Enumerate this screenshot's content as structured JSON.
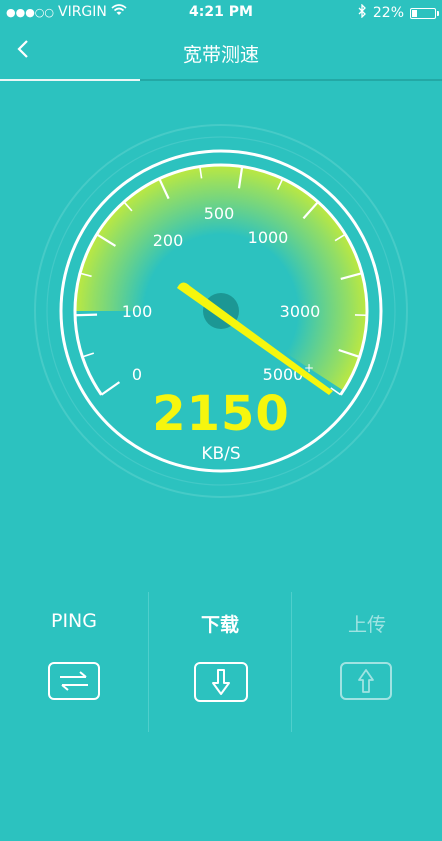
{
  "status_bar": {
    "signal": "●●●○○",
    "carrier": "VIRGIN",
    "time": "4:21 PM",
    "battery": "22%",
    "battery_level": 0.22
  },
  "nav": {
    "back_icon": "chevron-left-icon",
    "back_glyph": "<",
    "title": "宽带测速"
  },
  "gauge": {
    "tick_labels": [
      "0",
      "100",
      "200",
      "500",
      "1000",
      "3000",
      "5000"
    ],
    "plus_mark": "+",
    "speed_value": "2150",
    "speed_unit": "KB/S",
    "colors": {
      "arc": "#f6f60e",
      "needle": "#f6f60e",
      "hub": "#1a8f8c"
    }
  },
  "tabs": [
    {
      "label": "PING",
      "icon": "swap-arrows-icon",
      "active": false
    },
    {
      "label": "下载",
      "icon": "download-arrow-icon",
      "active": true
    },
    {
      "label": "上传",
      "icon": "upload-arrow-icon",
      "active": false,
      "dimmed": true
    }
  ],
  "colors": {
    "background": "#2cc2bf",
    "accent_yellow": "#f6f60e"
  }
}
